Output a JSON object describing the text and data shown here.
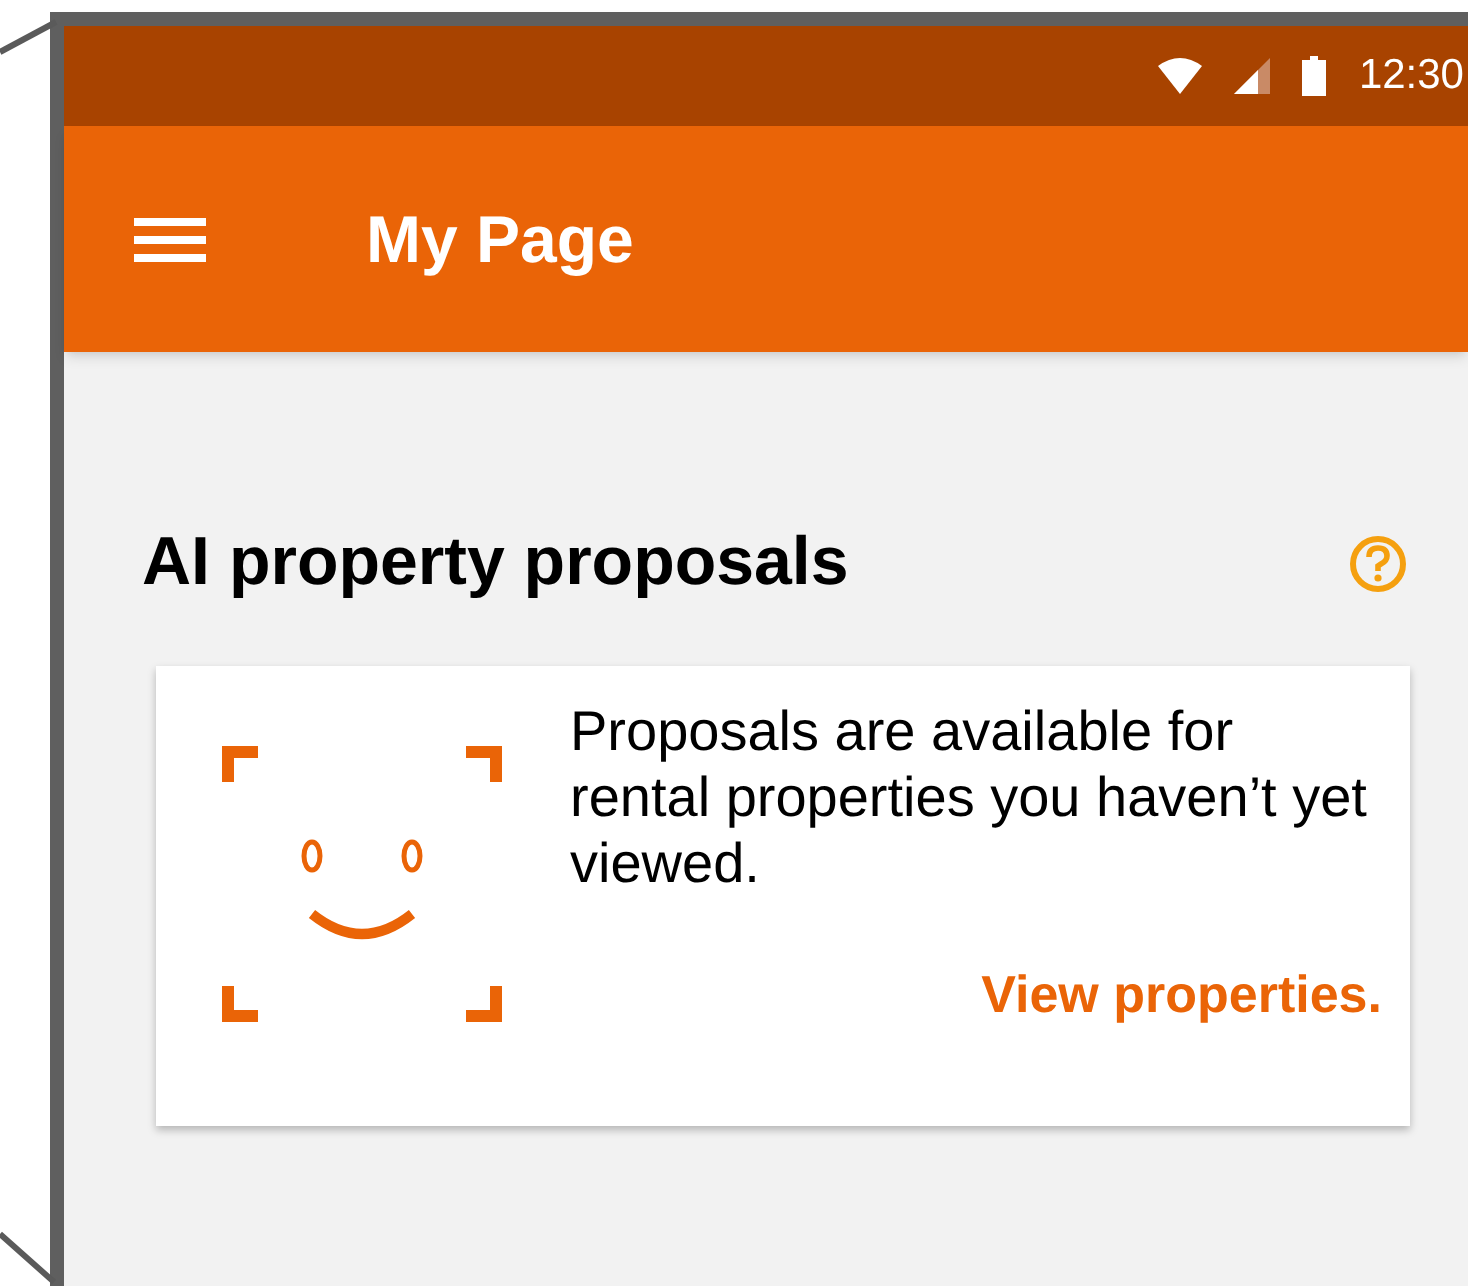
{
  "status_bar": {
    "time": "12:30"
  },
  "app_bar": {
    "title": "My Page"
  },
  "section": {
    "title": "AI property proposals"
  },
  "card": {
    "text": "Proposals are available for rental properties you haven’t yet viewed.",
    "link": "View properties."
  }
}
